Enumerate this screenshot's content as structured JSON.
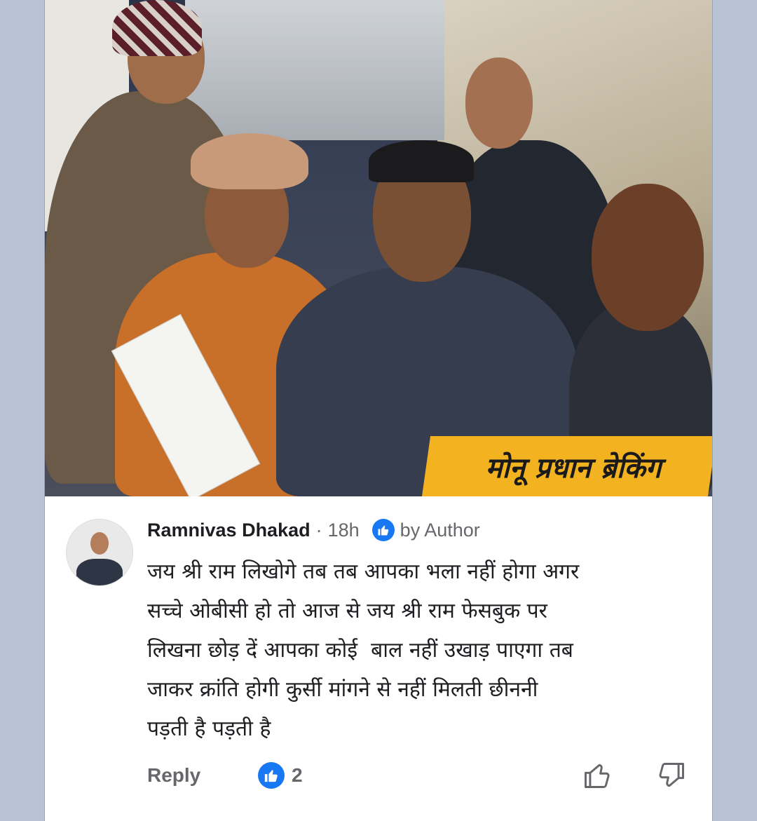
{
  "banner": {
    "text": "मोनू प्रधान ब्रेकिंग"
  },
  "comment": {
    "author_name": "Ramnivas Dhakad",
    "separator": "·",
    "time": "18h",
    "author_badge": "by Author",
    "text": "जय श्री राम लिखोगे तब तब आपका भला नहीं होगा अगर\nसच्चे ओबीसी हो तो आज से जय श्री राम फेसबुक पर\nलिखना छोड़ दें आपका कोई  बाल नहीं उखाड़ पाएगा तब\nजाकर क्रांति होगी कुर्सी मांगने से नहीं मिलती छीननी\nपड़ती है पड़ती है",
    "reply_label": "Reply",
    "like_count": "2"
  },
  "icons": {
    "author_badge_icon": "thumbs-up-icon",
    "reaction_icon": "thumbs-up-icon",
    "vote_up": "thumbs-up-outline-icon",
    "vote_down": "thumbs-down-outline-icon"
  },
  "colors": {
    "accent": "#1877f2",
    "banner": "#f3b220",
    "muted_text": "#65676b",
    "text": "#1c1e21"
  }
}
